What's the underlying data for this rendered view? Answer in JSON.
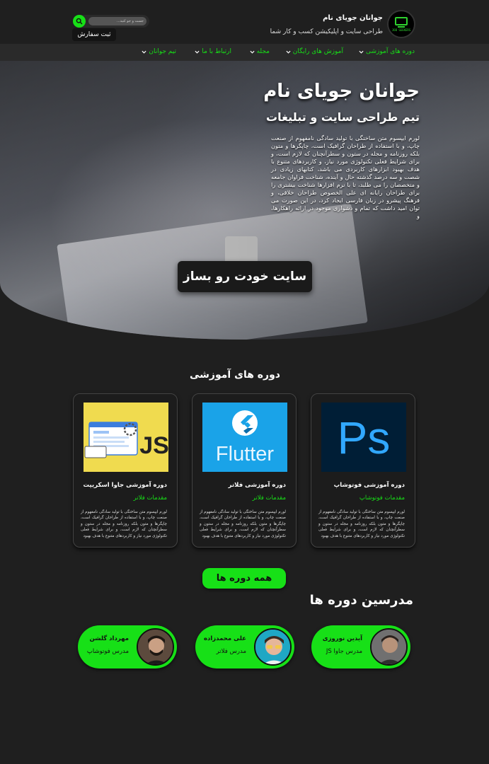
{
  "header": {
    "brand_title": "جوانان جویای نام",
    "brand_subtitle": "طراحی سایت و اپلیکیشن کسب و کار شما",
    "logo_caption": "JOB SEEKERS",
    "search_placeholder": "جست و جو کنید...",
    "order_label": "ثبت سفارش"
  },
  "nav": {
    "items": [
      {
        "label": "دوره های آموزشی"
      },
      {
        "label": "آموزش های رایگان"
      },
      {
        "label": "مجله"
      },
      {
        "label": "ارتباط با ما"
      },
      {
        "label": "تیم جوانان"
      }
    ]
  },
  "hero": {
    "title": "جوانان جویای نام",
    "subtitle": "تیم طراحی سایت و تبلیغات",
    "description": "لورم ایپسوم متن ساختگی با تولید سادگی نامفهوم از صنعت چاپ، و با استفاده از طراحان گرافیک است، چاپگرها و متون بلکه روزنامه و مجله در ستون و سطرآنچنان که لازم است، و برای شرایط فعلی تکنولوژی مورد نیاز، و کاربردهای متنوع با هدف بهبود ابزارهای کاربردی می باشد، کتابهای زیادی در شصت و سه درصد گذشته حال و آینده، شناخت فراوان جامعه و متخصصان را می طلبد، تا با نرم افزارها شناخت بیشتری را برای طراحان رایانه ای علی الخصوص طراحان خلاقی، و فرهنگ پیشرو در زبان فارسی ایجاد کرد، در این صورت می توان امید داشت که تمام و دشواری موجود در ارائه راهکارها، و",
    "cta_label": "سایت خودت رو بساز"
  },
  "courses": {
    "title": "دوره های آموزشی",
    "items": [
      {
        "image_text": "Ps",
        "title": "دوره آموزشی فوتوشاپ",
        "category": "مقدمات فوتوشاپ",
        "description": "لورم ایپسوم متن ساختگی با تولید سادگی نامفهوم از صنعت چاپ، و با استفاده از طراحان گرافیک است، چاپگرها و متون بلکه روزنامه و مجله در ستون و سطرآنچنان که لازم است، و برای شرایط فعلی تکنولوژی مورد نیاز و کاربردهای متنوع با هدف بهبود"
      },
      {
        "image_text": "Flutter",
        "title": "دوره آموزشی فلاتر",
        "category": "مقدمات فلاتر",
        "description": "لورم ایپسوم متن ساختگی با تولید سادگی نامفهوم از صنعت چاپ، و با استفاده از طراحان گرافیک است، چاپگرها و متون بلکه روزنامه و مجله در ستون و سطرآنچنان که لازم است، و برای شرایط فعلی تکنولوژی مورد نیاز و کاربردهای متنوع با هدف بهبود"
      },
      {
        "image_text": "JS",
        "title": "دوره آموزشی جاوا اسکریپت",
        "category": "مقدمات فلاتر",
        "description": "لورم ایپسوم متن ساختگی با تولید سادگی نامفهوم از صنعت چاپ، و با استفاده از طراحان گرافیک است، چاپگرها و متون بلکه روزنامه و مجله در ستون و سطرآنچنان که لازم است، و برای شرایط فعلی تکنولوژی مورد نیاز و کاربردهای متنوع با هدف بهبود"
      }
    ],
    "all_label": "همه دوره ها"
  },
  "teachers": {
    "title": "مدرسین دوره ها",
    "items": [
      {
        "name": "آیدین نوروزی",
        "role": "مدرس جاوا JS"
      },
      {
        "name": "علی محمدزاده",
        "role": "مدرس فلاتر"
      },
      {
        "name": "مهرداد گلشن",
        "role": "مدرس فوتوشاپ"
      }
    ]
  },
  "colors": {
    "accent": "#17e017",
    "background": "#1f1f1f",
    "card": "#1c1c1c",
    "photoshop_bg": "#001e36",
    "photoshop_fg": "#31a8ff",
    "flutter_bg": "#1aa3e8",
    "js_bg": "#f0db4f"
  },
  "icons": {
    "search": "search-icon",
    "dropdown": "chevron-down-icon",
    "logo": "laptop-logo-icon"
  }
}
